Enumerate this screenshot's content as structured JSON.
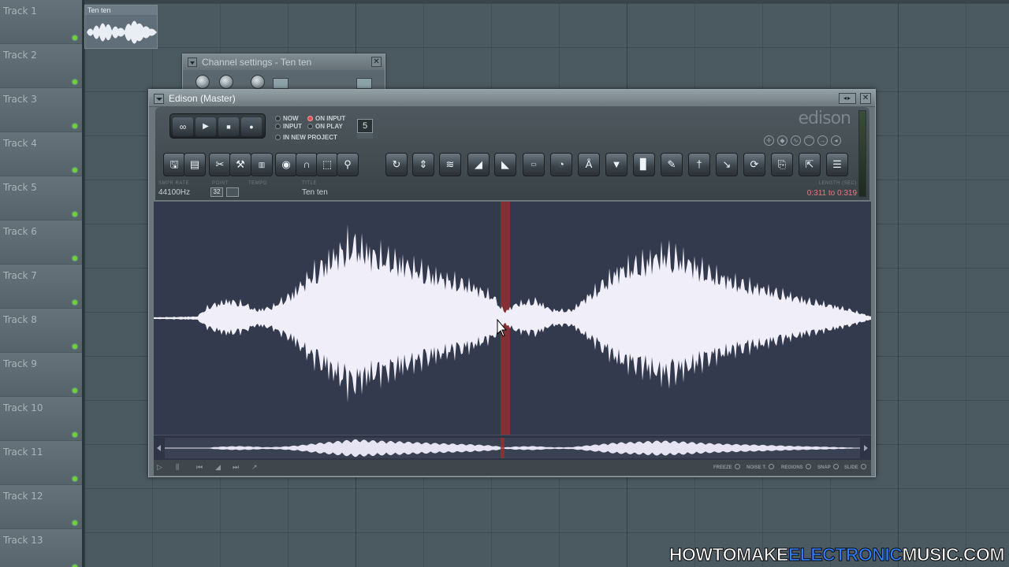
{
  "playlist": {
    "tracks": [
      "Track 1",
      "Track 2",
      "Track 3",
      "Track 4",
      "Track 5",
      "Track 6",
      "Track 7",
      "Track 8",
      "Track 9",
      "Track 10",
      "Track 11",
      "Track 12",
      "Track 13"
    ],
    "clip_title": "Ten ten"
  },
  "channel_settings": {
    "title": "Channel settings - Ten ten",
    "close": "✕"
  },
  "edison": {
    "title": "Edison (Master)",
    "logo": "edison",
    "close": "✕",
    "arrows": "◂▸",
    "transport": {
      "loop": "∞",
      "play": "▶",
      "stop": "■",
      "record": "●"
    },
    "record_options": {
      "now": "NOW",
      "input": "INPUT",
      "on_input": "ON INPUT",
      "on_play": "ON PLAY",
      "in_new_project": "IN NEW PROJECT",
      "number": "5"
    },
    "info": {
      "sample_rate_label": "SMPR RATE",
      "sample_rate": "44100Hz",
      "point_label": "POINT",
      "point_value": "32",
      "tempo_label": "TEMPO",
      "title_label": "TITLE",
      "title_value": "Ten ten",
      "length_label": "LENGTH (SEC)",
      "selection": "0:311 to 0:319"
    },
    "footer": {
      "freeze": "FREEZE",
      "noise": "NOISE T.",
      "regions": "REGIONS",
      "snap": "SNAP",
      "slide": "SLIDE"
    }
  },
  "watermark": {
    "part1": "HOWTOMAKE",
    "part2": "ELECTRONIC",
    "part3": "MUSIC.COM"
  },
  "colors": {
    "waveform_bg": "#333a4e",
    "waveform": "#f0eef8",
    "selection": "#a02c2c",
    "accent_blue": "#2d7fff"
  }
}
